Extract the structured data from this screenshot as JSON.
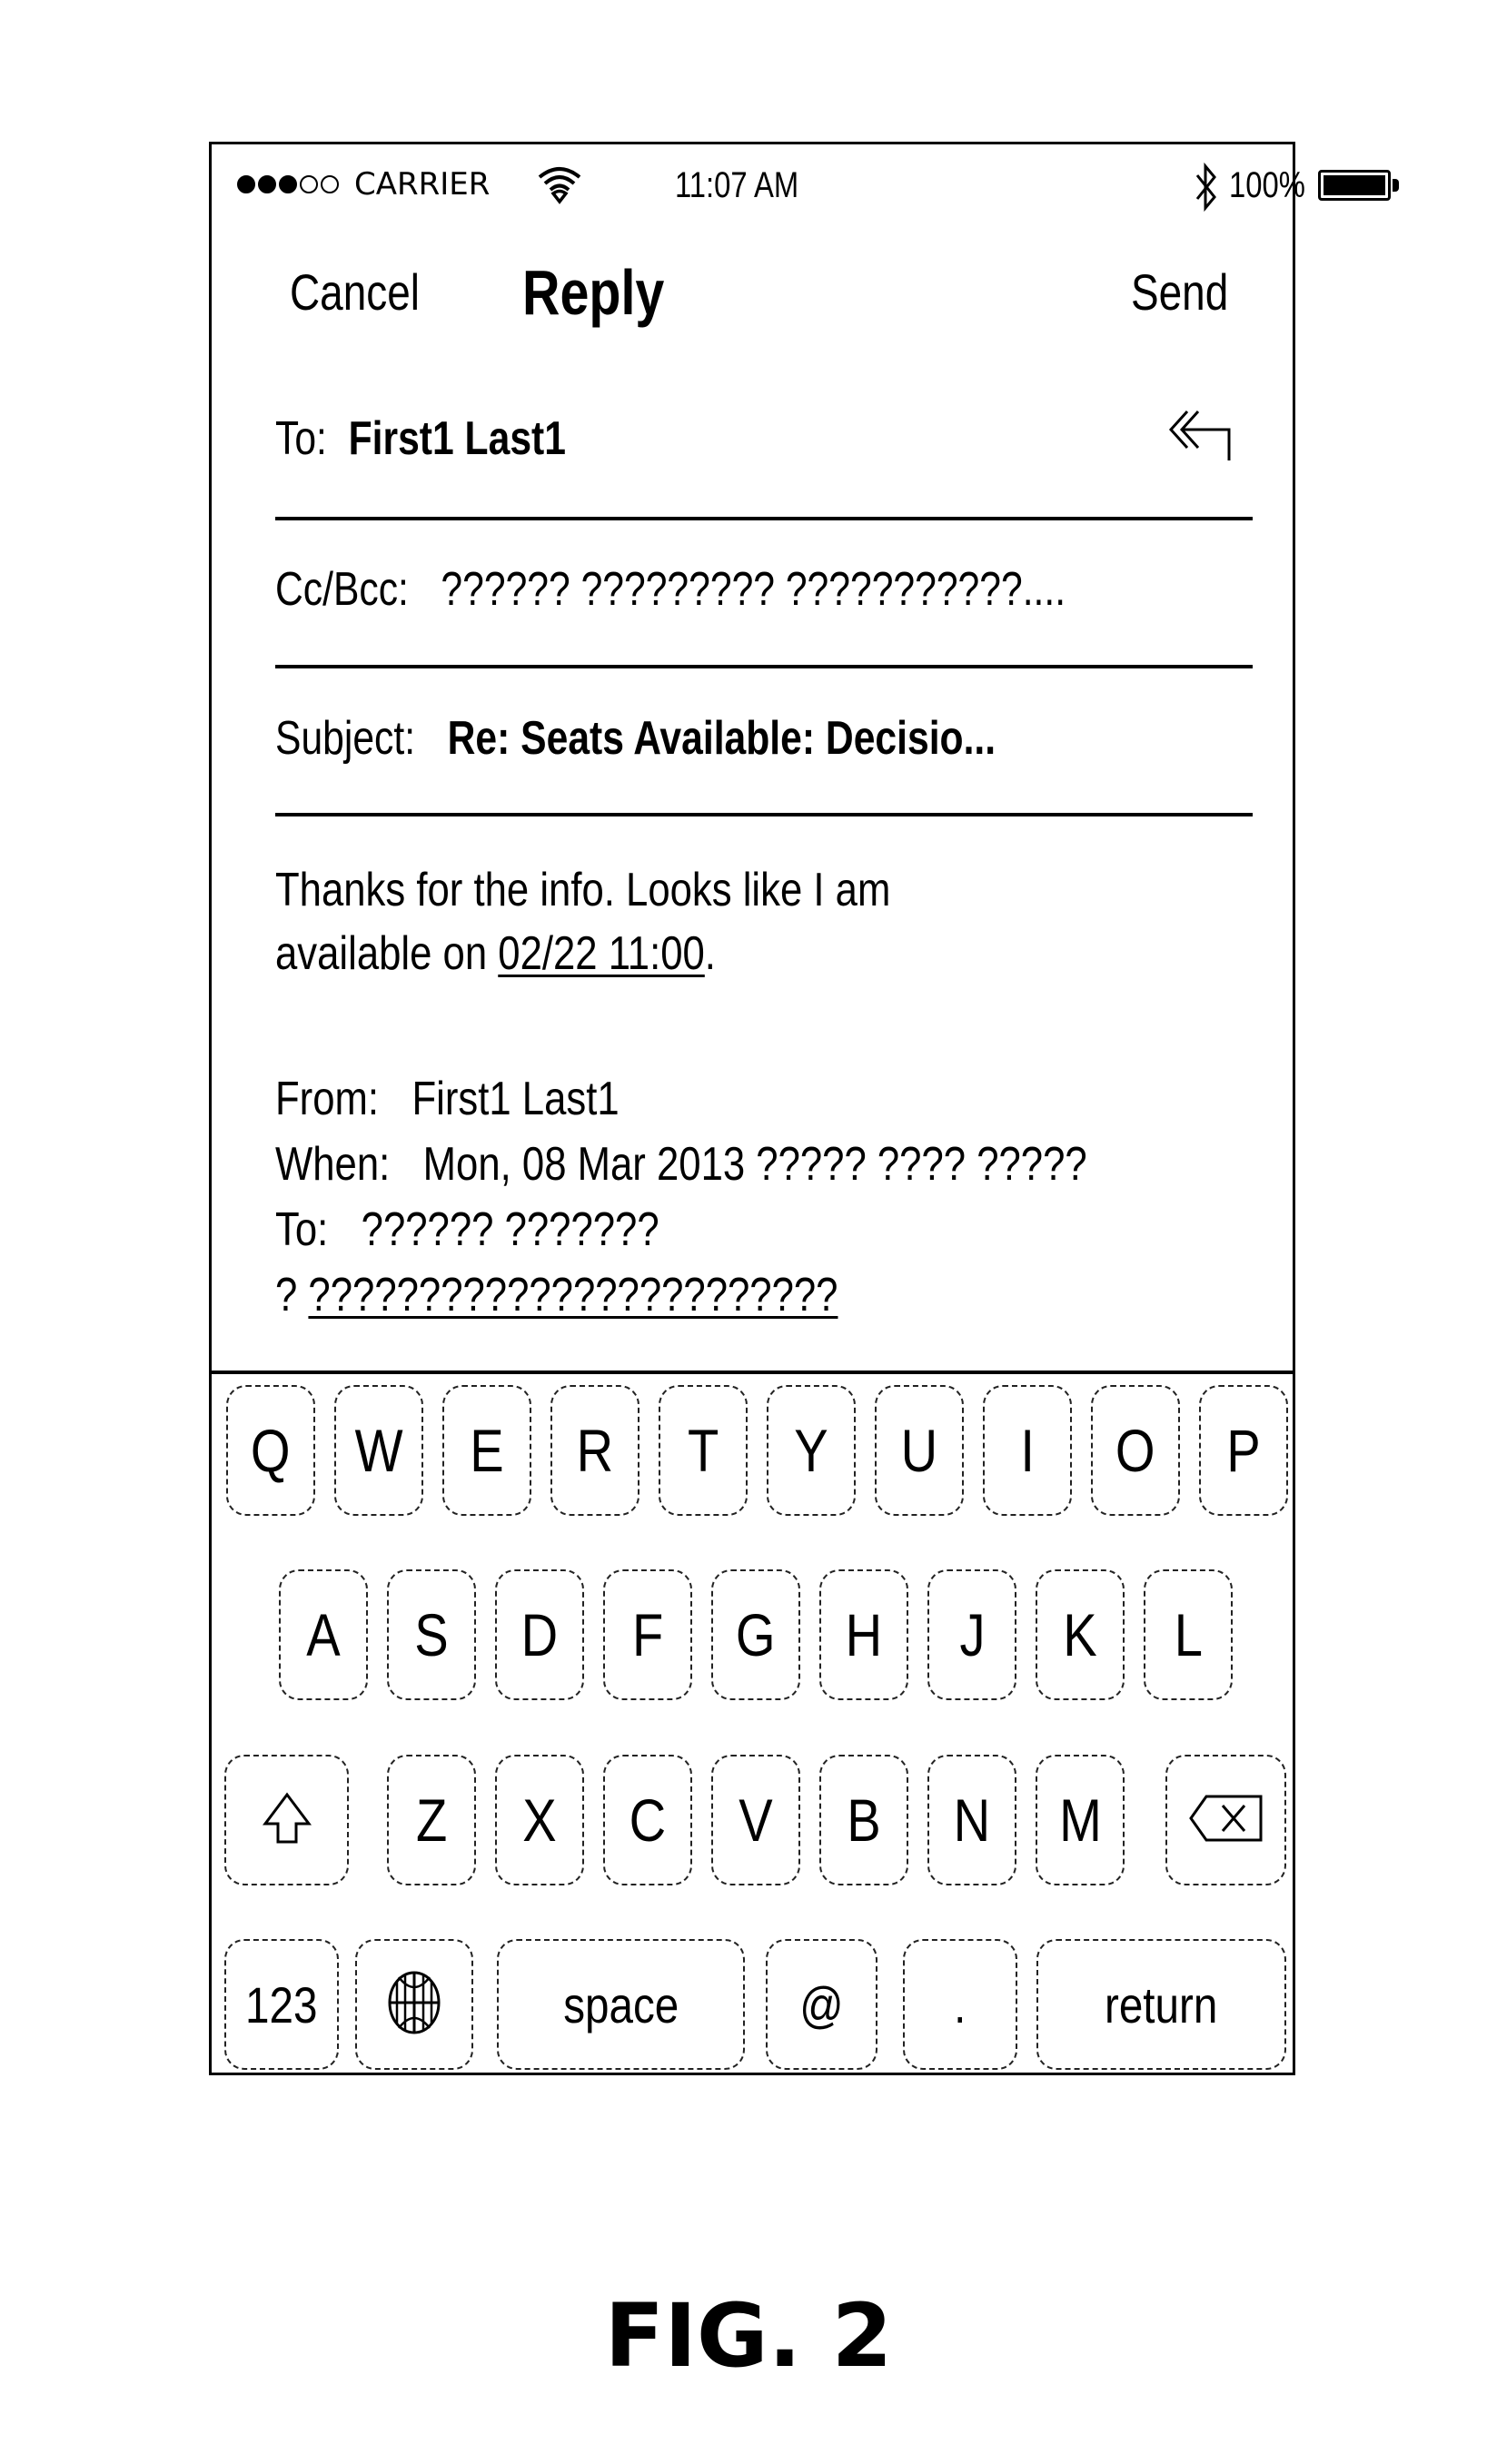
{
  "status_bar": {
    "signal": {
      "filled": 3,
      "total": 5
    },
    "carrier": "CARRIER",
    "wifi_icon": "wifi-icon",
    "time": "11:07 AM",
    "bluetooth_icon": "bluetooth-icon",
    "battery_percent": "100%",
    "battery_level": 1.0
  },
  "nav": {
    "cancel_label": "Cancel",
    "title": "Reply",
    "send_label": "Send"
  },
  "header": {
    "to_label": "To:",
    "to_value": "First1 Last1",
    "reply_all_icon": "reply-all-icon",
    "cc_label": "Cc/Bcc:",
    "cc_value": "?????? ????????? ???????????....",
    "subject_label": "Subject:",
    "subject_value": "Re: Seats Available: Decisio..."
  },
  "body": {
    "line1": "Thanks for the info.  Looks like I am",
    "line2_prefix": "available on ",
    "line2_link": "02/22 11:00",
    "line2_suffix": "."
  },
  "quoted": {
    "from_label": "From:",
    "from_value": "First1 Last1",
    "when_label": "When:",
    "when_value": "Mon, 08 Mar 2013 ????? ???? ?????",
    "to_label": "To:",
    "to_value": "?????? ???????",
    "extra_prefix": "?",
    "extra_link": "????????????????????????"
  },
  "keyboard": {
    "row1": [
      "Q",
      "W",
      "E",
      "R",
      "T",
      "Y",
      "U",
      "I",
      "O",
      "P"
    ],
    "row2": [
      "A",
      "S",
      "D",
      "F",
      "G",
      "H",
      "J",
      "K",
      "L"
    ],
    "row3": [
      "Z",
      "X",
      "C",
      "V",
      "B",
      "N",
      "M"
    ],
    "shift_icon": "shift-icon",
    "delete_icon": "delete-icon",
    "numbers_label": "123",
    "globe_icon": "globe-icon",
    "space_label": "space",
    "at_label": "@",
    "dot_label": ".",
    "return_label": "return"
  },
  "figure_label": "FIG. 2"
}
